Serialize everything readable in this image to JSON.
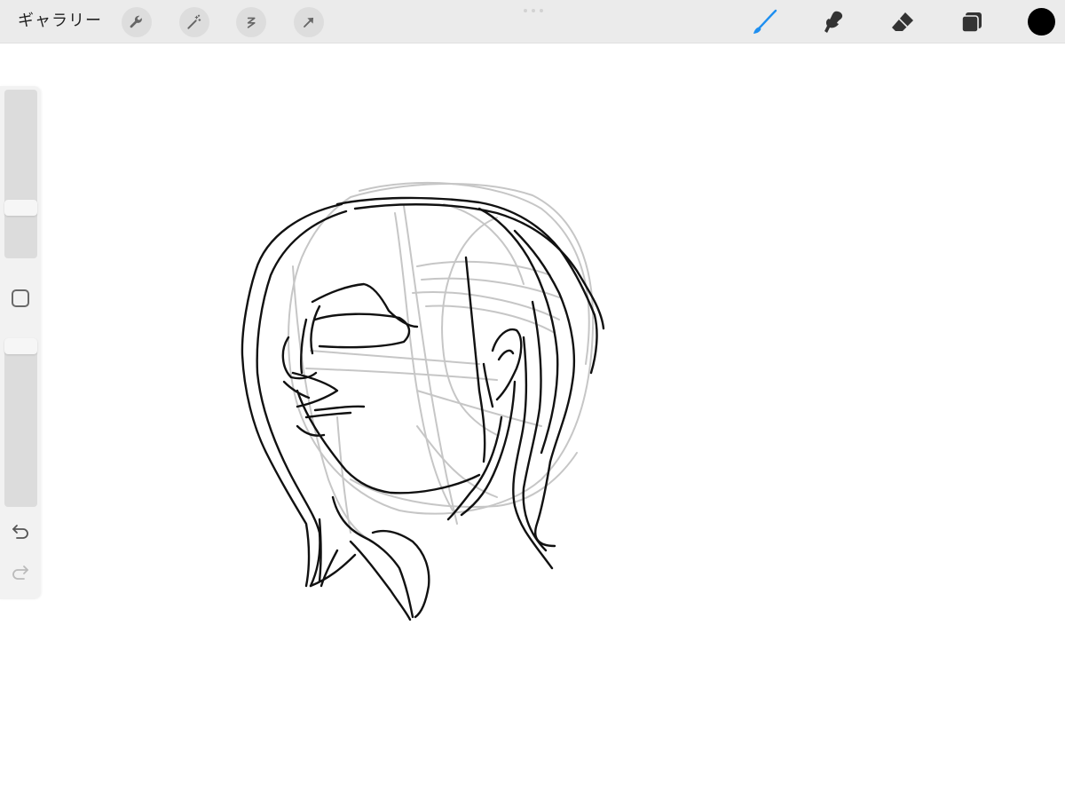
{
  "toolbar": {
    "gallery_label": "ギャラリー",
    "left_tools": [
      "wrench-icon",
      "magic-wand-icon",
      "selection-icon",
      "transform-arrow-icon"
    ],
    "right_tools": [
      "brush-icon",
      "smudge-icon",
      "eraser-icon",
      "layers-icon"
    ],
    "active_tool": "brush-icon",
    "active_color": "#1e8ff0",
    "current_color": "#000000"
  },
  "sidebar": {
    "brush_size": 0.72,
    "opacity": 0.0,
    "controls": [
      "brush-size-slider",
      "modify-button",
      "opacity-slider",
      "undo-icon",
      "redo-icon"
    ]
  },
  "canvas": {
    "background": "#ffffff",
    "content": "pencil-sketch"
  }
}
